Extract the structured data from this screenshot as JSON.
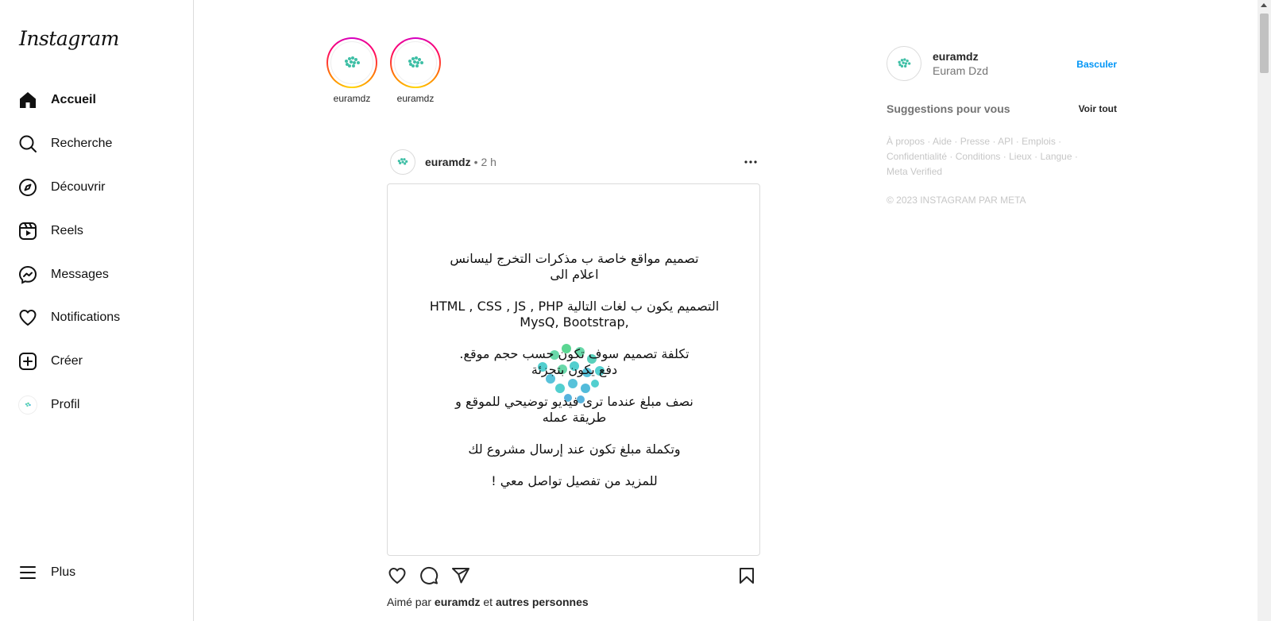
{
  "brand": {
    "logo_text": "Instagram"
  },
  "sidebar": {
    "items": [
      {
        "label": "Accueil",
        "icon": "home-icon"
      },
      {
        "label": "Recherche",
        "icon": "search-icon"
      },
      {
        "label": "Découvrir",
        "icon": "compass-icon"
      },
      {
        "label": "Reels",
        "icon": "reels-icon"
      },
      {
        "label": "Messages",
        "icon": "messenger-icon"
      },
      {
        "label": "Notifications",
        "icon": "heart-icon"
      },
      {
        "label": "Créer",
        "icon": "plus-square-icon"
      },
      {
        "label": "Profil",
        "icon": "avatar"
      }
    ],
    "more_label": "Plus"
  },
  "stories": [
    {
      "username": "euramdz"
    },
    {
      "username": "euramdz"
    }
  ],
  "post": {
    "username": "euramdz",
    "separator": "•",
    "time": "2 h",
    "paragraphs": [
      "تصميم مواقع خاصة ب مذكرات التخرج ليسانس\nاعلام الى",
      "التصميم يكون ب لغات التالية HTML , CSS , JS , PHP\n,MysQ, Bootstrap",
      "تكلفة تصميم سوف تكون حسب حجم موقع.\nدفع يكون بتجزئة",
      "نصف مبلغ عندما ترى فيديو توضيحي للموقع و\nطريقة عمله",
      "وتكملة مبلغ تكون عند إرسال مشروع لك",
      "للمزيد من تفصيل تواصل معي !"
    ],
    "likes_prefix": "Aimé par",
    "likes_user": "euramdz",
    "likes_and": "et",
    "likes_others": "autres personnes"
  },
  "right": {
    "username": "euramdz",
    "full_name": "Euram Dzd",
    "switch_label": "Basculer",
    "suggestions_title": "Suggestions pour vous",
    "see_all_label": "Voir tout",
    "footer_links": [
      "À propos",
      "Aide",
      "Presse",
      "API",
      "Emplois",
      "Confidentialité",
      "Conditions",
      "Lieux",
      "Langue",
      "Meta Verified"
    ],
    "copyright": "© 2023 INSTAGRAM PAR META"
  },
  "colors": {
    "accent": "#0095f6",
    "text": "#262626",
    "muted": "#737373",
    "border": "#dbdbdb"
  }
}
